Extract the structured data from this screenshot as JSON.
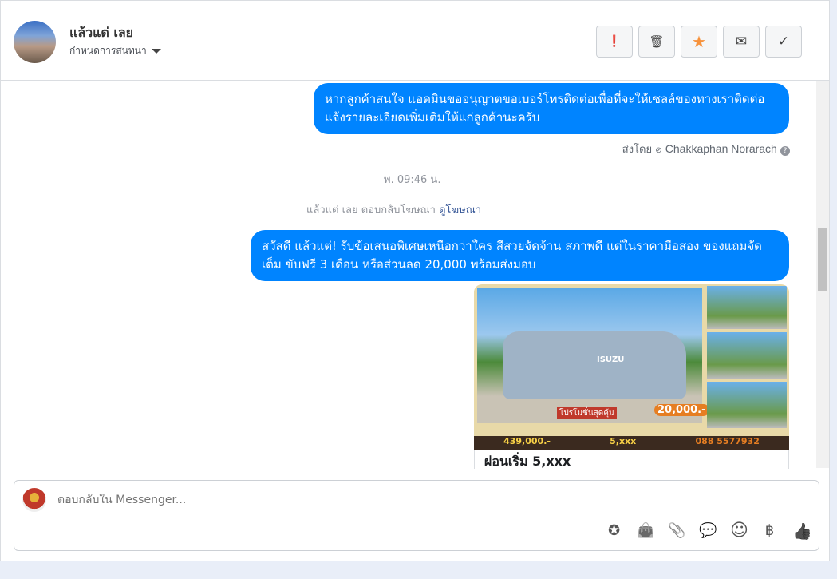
{
  "header": {
    "name": "แล้วแต่ เลย",
    "settings_label": "กำหนดการสนทนา",
    "actions": [
      {
        "icon": "alert-icon",
        "glyph": "❗"
      },
      {
        "icon": "trash-icon",
        "glyph": "🗑"
      },
      {
        "icon": "star-icon",
        "glyph": "★"
      },
      {
        "icon": "mail-icon",
        "glyph": "✉"
      },
      {
        "icon": "check-icon",
        "glyph": "✓"
      }
    ]
  },
  "messages": {
    "msg1": "หากลูกค้าสนใจ แอดมินขออนุญาตขอเบอร์โทรติดต่อเพื่อที่จะให้เชลล์ของทางเราติดต่อแจ้งรายละเอียดเพิ่มเติมให้แก่ลูกค้านะครับ",
    "sent_by_label": "ส่งโดย",
    "sent_by_name": "Chakkaphan Norarach",
    "timestamp": "พ. 09:46 น.",
    "ad_reply_text": "แล้วแต่ เลย ตอบกลับโฆษณา",
    "ad_link": "ดูโฆษณา",
    "msg2": "สวัสดี แล้วแต่! รับข้อเสนอพิเศษเหนือกว่าใคร สีสวยจัดจ้าน สภาพดี แต่ในราคามือสอง ของแถมจัดเต็ม ขับฟรี 3 เดือน หรือส่วนลด 20,000 พร้อมส่งมอบ",
    "ad_image": {
      "brand": "ISUZU",
      "promo": "โปรโมชั่นสุดคุ้ม",
      "discount": "20,000.-",
      "price": "439,000.-",
      "installment": "5,xxx",
      "phone": "088 5577932"
    },
    "ad_caption": "ผ่อนเริ่ม 5,xxx"
  },
  "composer": {
    "placeholder": "ตอบกลับใน Messenger...",
    "tools": [
      {
        "icon": "saved-reply-icon",
        "glyph": "✪"
      },
      {
        "icon": "shop-bag-icon",
        "glyph": "👜"
      },
      {
        "icon": "paperclip-icon",
        "glyph": "📎"
      },
      {
        "icon": "chat-dots-icon",
        "glyph": "💬"
      },
      {
        "icon": "emoji-icon",
        "glyph": "☺"
      },
      {
        "icon": "baht-icon",
        "glyph": "฿"
      },
      {
        "icon": "thumbs-up-icon",
        "glyph": "👍"
      }
    ]
  },
  "colors": {
    "bubble": "#0084ff",
    "link": "#385898"
  }
}
